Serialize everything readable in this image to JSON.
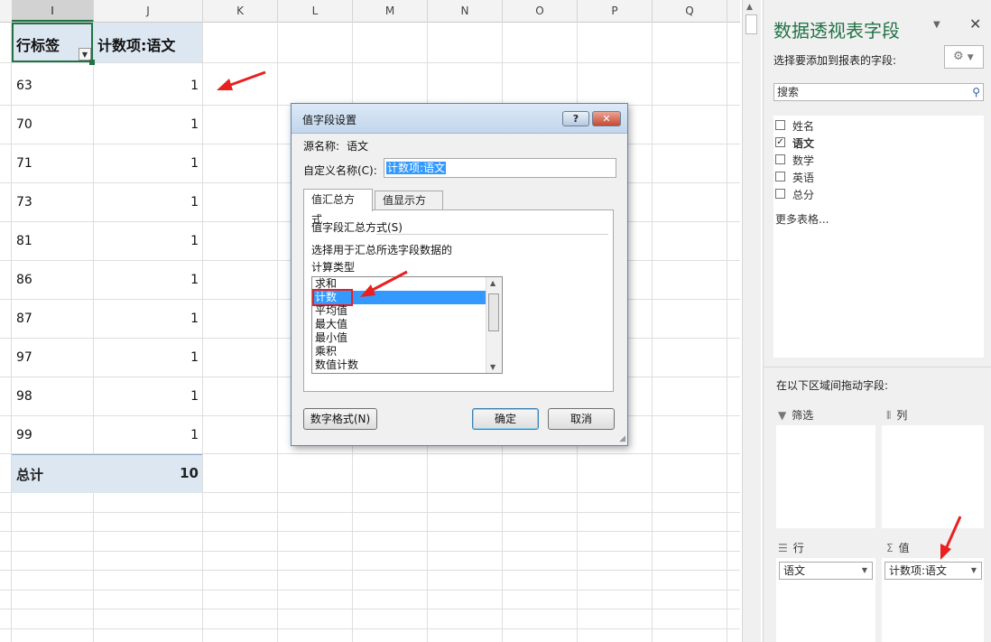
{
  "sheet": {
    "columns": [
      "I",
      "J",
      "K",
      "L",
      "M",
      "N",
      "O",
      "P",
      "Q"
    ],
    "pivot_header_row_label": "行标签",
    "pivot_header_value_label": "计数项:语文",
    "rows": [
      {
        "key": "63",
        "value": "1"
      },
      {
        "key": "70",
        "value": "1"
      },
      {
        "key": "71",
        "value": "1"
      },
      {
        "key": "73",
        "value": "1"
      },
      {
        "key": "81",
        "value": "1"
      },
      {
        "key": "86",
        "value": "1"
      },
      {
        "key": "87",
        "value": "1"
      },
      {
        "key": "97",
        "value": "1"
      },
      {
        "key": "98",
        "value": "1"
      },
      {
        "key": "99",
        "value": "1"
      }
    ],
    "total_label": "总计",
    "total_value": "10"
  },
  "dialog": {
    "title": "值字段设置",
    "help_label": "?",
    "close_label": "✕",
    "source_label": "源名称:",
    "source_value": "语文",
    "custom_name_label": "自定义名称(C):",
    "custom_name_value": "计数项:语文",
    "tabs": [
      "值汇总方式",
      "值显示方式"
    ],
    "group_label": "值字段汇总方式(S)",
    "instruction_line1": "选择用于汇总所选字段数据的",
    "instruction_line2": "计算类型",
    "calc_types": [
      "求和",
      "计数",
      "平均值",
      "最大值",
      "最小值",
      "乘积",
      "数值计数"
    ],
    "selected_calc_type": "计数",
    "number_format_label": "数字格式(N)",
    "ok_label": "确定",
    "cancel_label": "取消"
  },
  "pane": {
    "title": "数据透视表字段",
    "prompt": "选择要添加到报表的字段:",
    "search_placeholder": "搜索",
    "fields": [
      {
        "name": "姓名",
        "checked": false
      },
      {
        "name": "语文",
        "checked": true
      },
      {
        "name": "数学",
        "checked": false
      },
      {
        "name": "英语",
        "checked": false
      },
      {
        "name": "总分",
        "checked": false
      }
    ],
    "more_tables": "更多表格...",
    "drag_prompt": "在以下区域间拖动字段:",
    "zones": {
      "filters": "筛选",
      "columns": "列",
      "rows": "行",
      "values": "值"
    },
    "rows_item": "语文",
    "values_item": "计数项:语文"
  },
  "colors": {
    "accent": "#217346",
    "pivot_header_bg": "#dde7f1",
    "selection": "#3399ff",
    "annotation_red": "#e82020"
  }
}
